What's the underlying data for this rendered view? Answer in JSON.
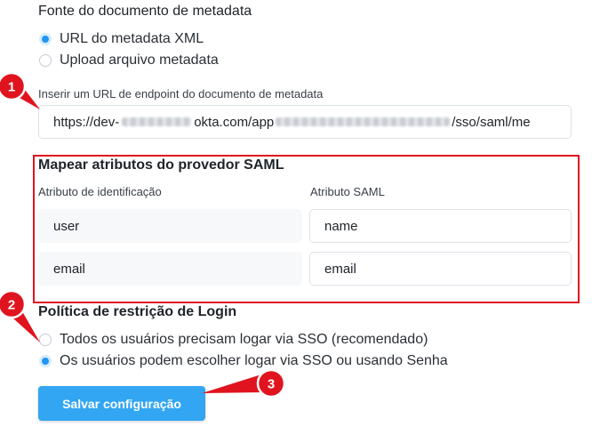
{
  "metadata_source": {
    "title": "Fonte do documento de metadata",
    "options": [
      {
        "label": "URL do metadata XML",
        "selected": true
      },
      {
        "label": "Upload arquivo metadata",
        "selected": false
      }
    ],
    "url_label": "Inserir um URL de endpoint do documento de metadata",
    "url_prefix": "https://dev-",
    "url_mid": "okta.com/app",
    "url_suffix": "/sso/saml/me"
  },
  "attribute_mapping": {
    "title": "Mapear atributos do provedor SAML",
    "col_identification": "Atributo de identificação",
    "col_saml": "Atributo SAML",
    "rows": [
      {
        "identification": "user",
        "saml": "name"
      },
      {
        "identification": "email",
        "saml": "email"
      }
    ]
  },
  "login_policy": {
    "title": "Política de restrição de Login",
    "options": [
      {
        "label": "Todos os usuários precisam logar via SSO (recomendado)",
        "selected": false
      },
      {
        "label": "Os usuários podem escolher logar via SSO ou usando Senha",
        "selected": true
      }
    ]
  },
  "save_button": {
    "label": "Salvar configuração"
  },
  "annotations": {
    "badges": [
      "1",
      "2",
      "3"
    ],
    "color": "#e0141e",
    "highlight_color": "#e0141e"
  },
  "colors": {
    "accent": "#2196f3",
    "button": "#32a6f2"
  }
}
